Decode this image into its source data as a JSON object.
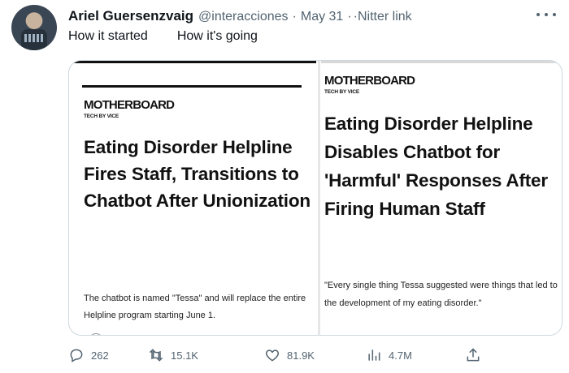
{
  "tweet": {
    "author_name": "Ariel Guersenzvaig",
    "handle": "@interacciones",
    "separator": "·",
    "date": "May 31",
    "source_link": "·Nitter link",
    "subtitle_left": "How it started",
    "subtitle_right": "How it's going"
  },
  "image_left": {
    "brand": "MOTHERBOARD",
    "tagline": "TECH BY VICE",
    "headline": "Eating Disorder Helpline Fires Staff, Transitions to Chatbot After Unionization",
    "body": "The chatbot is named \"Tessa\" and will replace the entire Helpline program starting June 1."
  },
  "image_right": {
    "brand": "MOTHERBOARD",
    "tagline": "TECH BY VICE",
    "headline": "Eating Disorder Helpline Disables Chatbot for 'Harmful' Responses After Firing Human Staff",
    "body": "\"Every single thing Tessa suggested were things that led to the development of my eating disorder.\""
  },
  "actions": {
    "replies": "262",
    "retweets": "15.1K",
    "likes": "81.9K",
    "views": "4.7M"
  },
  "icons": {
    "reply": "reply-icon",
    "retweet": "retweet-icon",
    "like": "heart-icon",
    "views": "views-icon",
    "share": "share-icon",
    "more": "more-icon"
  },
  "colors": {
    "text_primary": "#0f1419",
    "text_secondary": "#536471",
    "border": "#cfd9de"
  }
}
